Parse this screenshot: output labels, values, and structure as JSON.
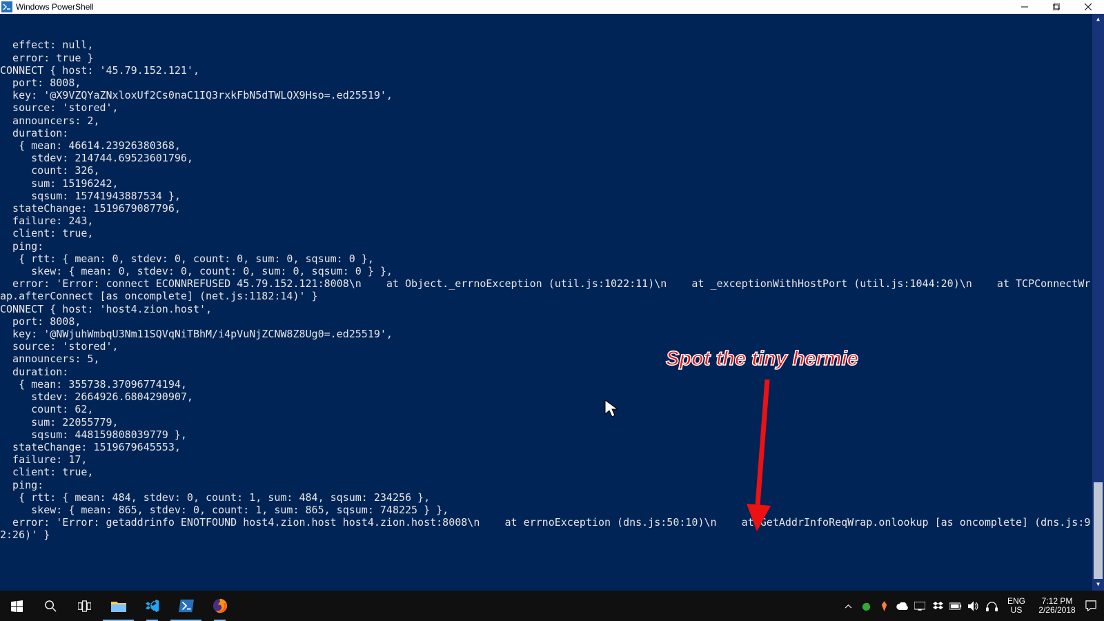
{
  "window": {
    "title": "Windows PowerShell"
  },
  "terminal": {
    "lines": "  effect: null,\n  error: true }\nCONNECT { host: '45.79.152.121',\n  port: 8008,\n  key: '@X9VZQYaZNxloxUf2Cs0naC1IQ3rxkFbN5dTWLQX9Hso=.ed25519',\n  source: 'stored',\n  announcers: 2,\n  duration:\n   { mean: 46614.23926380368,\n     stdev: 214744.69523601796,\n     count: 326,\n     sum: 15196242,\n     sqsum: 15741943887534 },\n  stateChange: 1519679087796,\n  failure: 243,\n  client: true,\n  ping:\n   { rtt: { mean: 0, stdev: 0, count: 0, sum: 0, sqsum: 0 },\n     skew: { mean: 0, stdev: 0, count: 0, sum: 0, sqsum: 0 } },\n  error: 'Error: connect ECONNREFUSED 45.79.152.121:8008\\n    at Object._errnoException (util.js:1022:11)\\n    at _exceptionWithHostPort (util.js:1044:20)\\n    at TCPConnectWr\nap.afterConnect [as oncomplete] (net.js:1182:14)' }\nCONNECT { host: 'host4.zion.host',\n  port: 8008,\n  key: '@NWjuhWmbqU3Nm11SQVqNiTBhM/i4pVuNjZCNW8Z8Ug0=.ed25519',\n  source: 'stored',\n  announcers: 5,\n  duration:\n   { mean: 355738.37096774194,\n     stdev: 2664926.6804290907,\n     count: 62,\n     sum: 22055779,\n     sqsum: 448159808039779 },\n  stateChange: 1519679645553,\n  failure: 17,\n  client: true,\n  ping:\n   { rtt: { mean: 484, stdev: 0, count: 1, sum: 484, sqsum: 234256 },\n     skew: { mean: 865, stdev: 0, count: 1, sum: 865, sqsum: 748225 } },\n  error: 'Error: getaddrinfo ENOTFOUND host4.zion.host host4.zion.host:8008\\n    at errnoException (dns.js:50:10)\\n    at GetAddrInfoReqWrap.onlookup [as oncomplete] (dns.js:9\n2:26)' }\n"
  },
  "annotation": {
    "text": "Spot the tiny hermie"
  },
  "tray": {
    "lang_primary": "ENG",
    "lang_secondary": "US",
    "time": "7:12 PM",
    "date": "2/26/2018"
  }
}
